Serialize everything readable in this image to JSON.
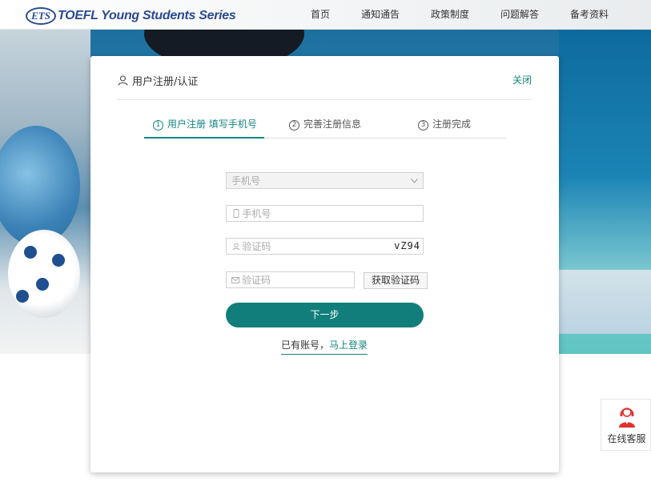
{
  "header": {
    "logo_badge": "ETS",
    "logo_text": "TOEFL Young Students Series",
    "nav": [
      "首页",
      "通知通告",
      "政策制度",
      "问题解答",
      "备考资料"
    ]
  },
  "modal": {
    "title": "用户注册/认证",
    "close_label": "关闭",
    "steps": [
      {
        "num": "1",
        "label": "用户注册 填写手机号",
        "active": true
      },
      {
        "num": "2",
        "label": "完善注册信息",
        "active": false
      },
      {
        "num": "3",
        "label": "注册完成",
        "active": false
      }
    ],
    "form": {
      "country_select_placeholder": "手机号",
      "phone_placeholder": "手机号",
      "captcha_placeholder": "验证码",
      "captcha_image_text": "vZ94",
      "sms_code_placeholder": "验证码",
      "get_code_label": "获取验证码",
      "next_label": "下一步",
      "have_account_text": "已有账号，",
      "login_link": "马上登录"
    }
  },
  "service": {
    "label": "在线客服"
  },
  "colors": {
    "accent": "#14857f",
    "button": "#127e7c",
    "brand": "#2a4a8f"
  }
}
